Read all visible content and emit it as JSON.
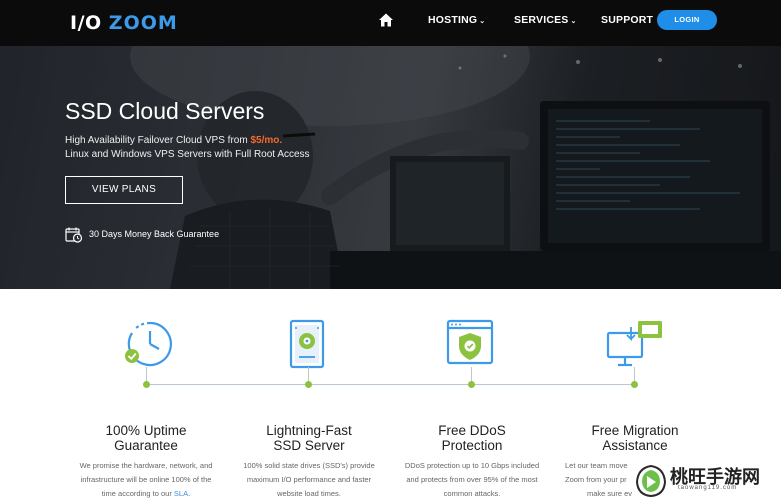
{
  "nav": {
    "logo_io": "I/O",
    "logo_zoom": "ZOOM",
    "items": [
      {
        "label": "HOSTING",
        "dropdown": true
      },
      {
        "label": "SERVICES",
        "dropdown": true
      },
      {
        "label": "SUPPORT",
        "dropdown": false
      }
    ],
    "login_label": "LOGIN"
  },
  "hero": {
    "title": "SSD Cloud Servers",
    "line1_prefix": "High Availability Failover Cloud VPS from ",
    "line1_price": "$5/mo.",
    "line2": "Linux and Windows VPS Servers with Full Root Access",
    "cta_label": "VIEW PLANS",
    "guarantee": "30 Days Money Back Guarantee"
  },
  "features": [
    {
      "icon": "clock-check-icon",
      "title_1": "100% Uptime",
      "title_2": "Guarantee",
      "desc_1": "We promise the hardware, network, and",
      "desc_2": "infrastructure will be online 100% of the",
      "desc_3": "time according to our ",
      "desc_link": "SLA."
    },
    {
      "icon": "hard-drive-icon",
      "title_1": "Lightning-Fast",
      "title_2": "SSD Server",
      "desc_1": "100% solid state drives (SSD's) provide",
      "desc_2": "maximum I/O performance and faster",
      "desc_3": "website load times."
    },
    {
      "icon": "shield-browser-icon",
      "title_1": "Free DDoS",
      "title_2": "Protection",
      "desc_1": "DDoS protection up to 10 Gbps included",
      "desc_2": "and protects from over 95% of the most",
      "desc_3": "common attacks."
    },
    {
      "icon": "monitor-transfer-icon",
      "title_1": "Free Migration",
      "title_2": "Assistance",
      "desc_1": "Let our team move",
      "desc_2": "Zoom from your pr",
      "desc_3": "make sure ev"
    }
  ],
  "watermark": {
    "text": "桃旺手游网",
    "sub": "taowang119.com"
  },
  "colors": {
    "accent_blue": "#1e8ee8",
    "price_orange": "#f26a2e",
    "timeline_green": "#8cc23f",
    "icon_blue": "#3d9ae8"
  }
}
